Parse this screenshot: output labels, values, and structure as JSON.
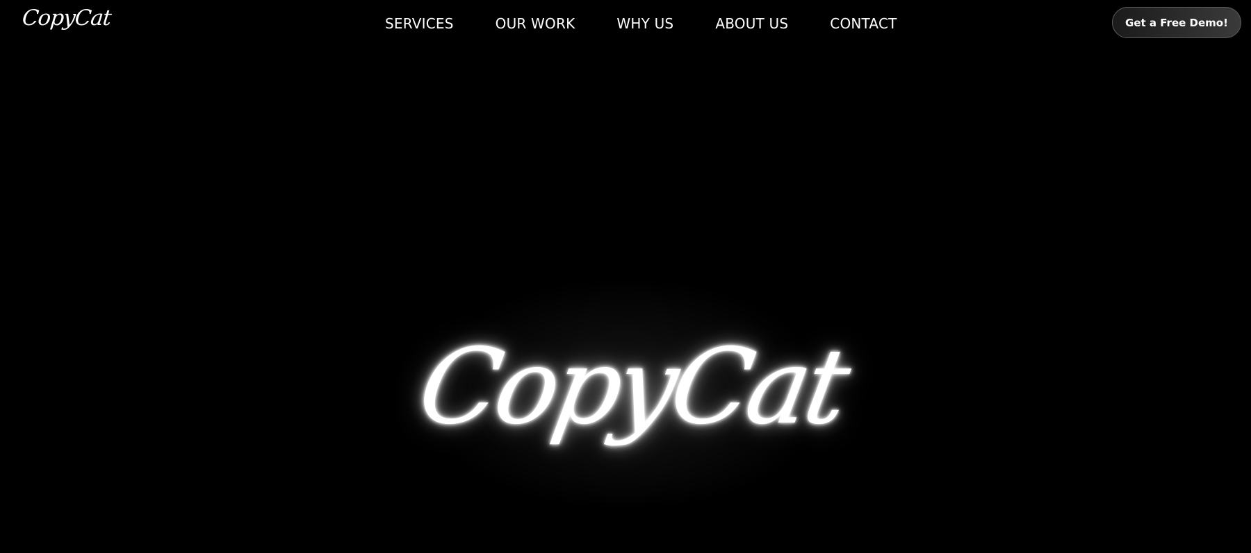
{
  "header": {
    "brand": "CopyCat",
    "nav": [
      {
        "label": "SERVICES"
      },
      {
        "label": "OUR WORK"
      },
      {
        "label": "WHY US"
      },
      {
        "label": "ABOUT US"
      },
      {
        "label": "CONTACT"
      }
    ],
    "cta_label": "Get a Free Demo!"
  },
  "hero": {
    "logo_text": "CopyCat"
  },
  "colors": {
    "background": "#000000",
    "text": "#ffffff",
    "cta_gradient_start": "#1b1b1b",
    "cta_gradient_end": "#3a3a3a"
  }
}
